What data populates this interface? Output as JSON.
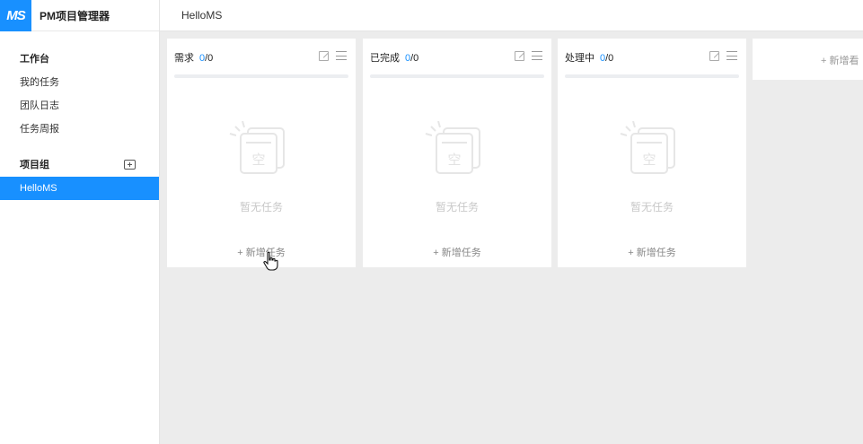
{
  "brand": {
    "logo": "MS",
    "title": "PM项目管理器"
  },
  "sidebar": {
    "workbench_label": "工作台",
    "items": [
      {
        "label": "我的任务"
      },
      {
        "label": "团队日志"
      },
      {
        "label": "任务周报"
      }
    ],
    "group_label": "项目组",
    "group_add_icon": "add-square-icon",
    "projects": [
      {
        "label": "HelloMS",
        "active": true
      }
    ]
  },
  "header": {
    "title": "HelloMS"
  },
  "board": {
    "columns": [
      {
        "title": "需求",
        "done": "0",
        "total": "/0",
        "empty_text": "暂无任务",
        "add_label": "+ 新增任务"
      },
      {
        "title": "已完成",
        "done": "0",
        "total": "/0",
        "empty_text": "暂无任务",
        "add_label": "+ 新增任务"
      },
      {
        "title": "处理中",
        "done": "0",
        "total": "/0",
        "empty_text": "暂无任务",
        "add_label": "+ 新增任务"
      }
    ],
    "add_board_label": "+ 新增看",
    "empty_icon_glyph": "空"
  },
  "colors": {
    "accent": "#1890ff",
    "background": "#ececec"
  }
}
